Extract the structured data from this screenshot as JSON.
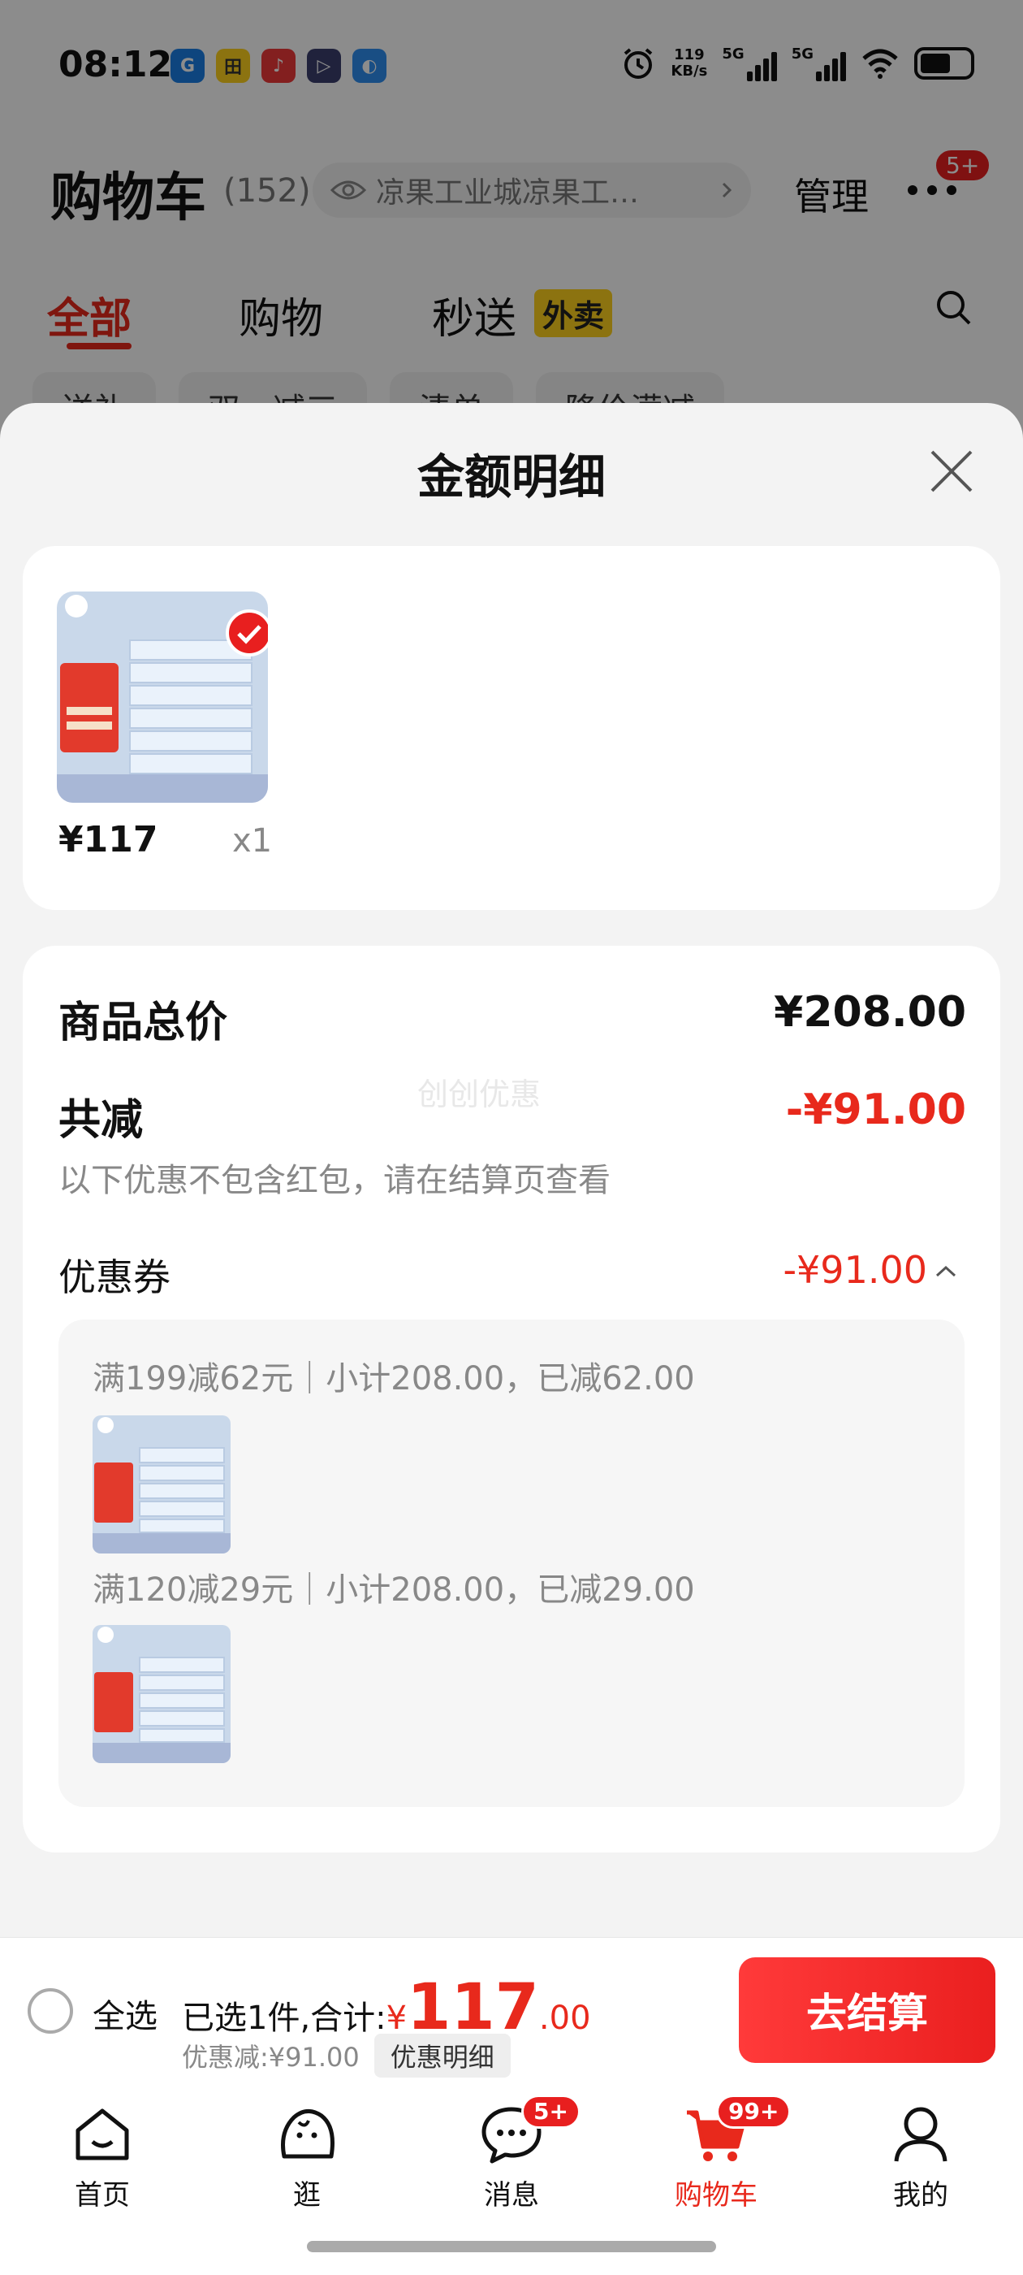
{
  "status_bar": {
    "time": "08:12",
    "net_speed_value": "119",
    "net_speed_unit": "KB/s",
    "sim1_label": "5G",
    "sim2_label": "5G",
    "app_icons": [
      "app-icon-1",
      "app-icon-2",
      "app-icon-3",
      "app-icon-4",
      "app-icon-5"
    ],
    "icons": [
      "alarm-icon",
      "signal-icon",
      "wifi-icon",
      "battery-icon"
    ]
  },
  "cart_header": {
    "title": "购物车",
    "count": "(152)",
    "address": "凉果工业城凉果工…",
    "manage_label": "管理",
    "more_badge": "5+"
  },
  "top_tabs": [
    {
      "label": "全部",
      "active": true
    },
    {
      "label": "购物",
      "active": false
    },
    {
      "label": "秒送",
      "active": false
    }
  ],
  "top_tab_badge": "外卖",
  "filter_chips": [
    "送礼",
    "双一减三",
    "清单",
    "降价满减"
  ],
  "sheet": {
    "title": "金额明细",
    "item": {
      "price": "¥117",
      "qty": "x1"
    },
    "total_label": "商品总价",
    "total_value": "¥208.00",
    "reduce_label": "共减",
    "reduce_value": "-¥91.00",
    "note": "以下优惠不包含红包，请在结算页查看",
    "watermark": "创创优惠",
    "coupon_label": "优惠券",
    "coupon_value": "-¥91.00",
    "coupons": [
      {
        "text": "满199减62元｜小计208.00，已减62.00"
      },
      {
        "text": "满120减29元｜小计208.00，已减29.00"
      }
    ]
  },
  "action_bar": {
    "select_all": "全选",
    "selected_prefix": "已选1件,合计:",
    "yen": "¥",
    "total_int": "117",
    "total_dec": ".00",
    "discount_text": "优惠减:¥91.00",
    "detail_button": "优惠明细",
    "checkout_button": "去结算"
  },
  "bottom_nav": [
    {
      "label": "首页",
      "icon": "home-icon",
      "active": false
    },
    {
      "label": "逛",
      "icon": "browse-icon",
      "active": false
    },
    {
      "label": "消息",
      "icon": "message-icon",
      "active": false,
      "badge": "5+"
    },
    {
      "label": "购物车",
      "icon": "cart-icon",
      "active": true,
      "badge": "99+"
    },
    {
      "label": "我的",
      "icon": "profile-icon",
      "active": false
    }
  ],
  "colors": {
    "accent_red": "#e8291c",
    "badge_red": "#e81f1f",
    "waimai_yellow": "#ffd21e"
  }
}
